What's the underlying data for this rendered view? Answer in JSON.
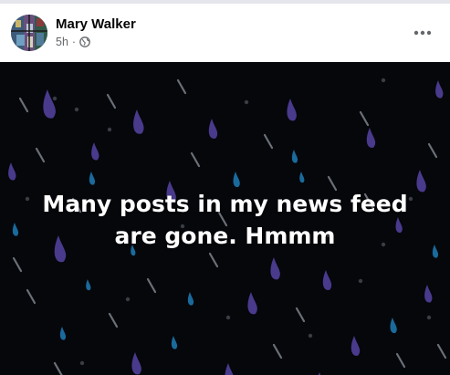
{
  "post": {
    "author": "Mary Walker",
    "time": "5h",
    "separator": "·",
    "privacy_icon": "globe-icon",
    "menu_icon": "more-horizontal-icon",
    "text_lines": [
      "Many posts in my news feed",
      "are gone. Hmmm"
    ]
  },
  "colors": {
    "background": "#05070b",
    "drop_purple": "#4a3a8c",
    "drop_blue": "#1a6a9c",
    "streak_gray": "#6b6f78",
    "text": "#ffffff"
  }
}
